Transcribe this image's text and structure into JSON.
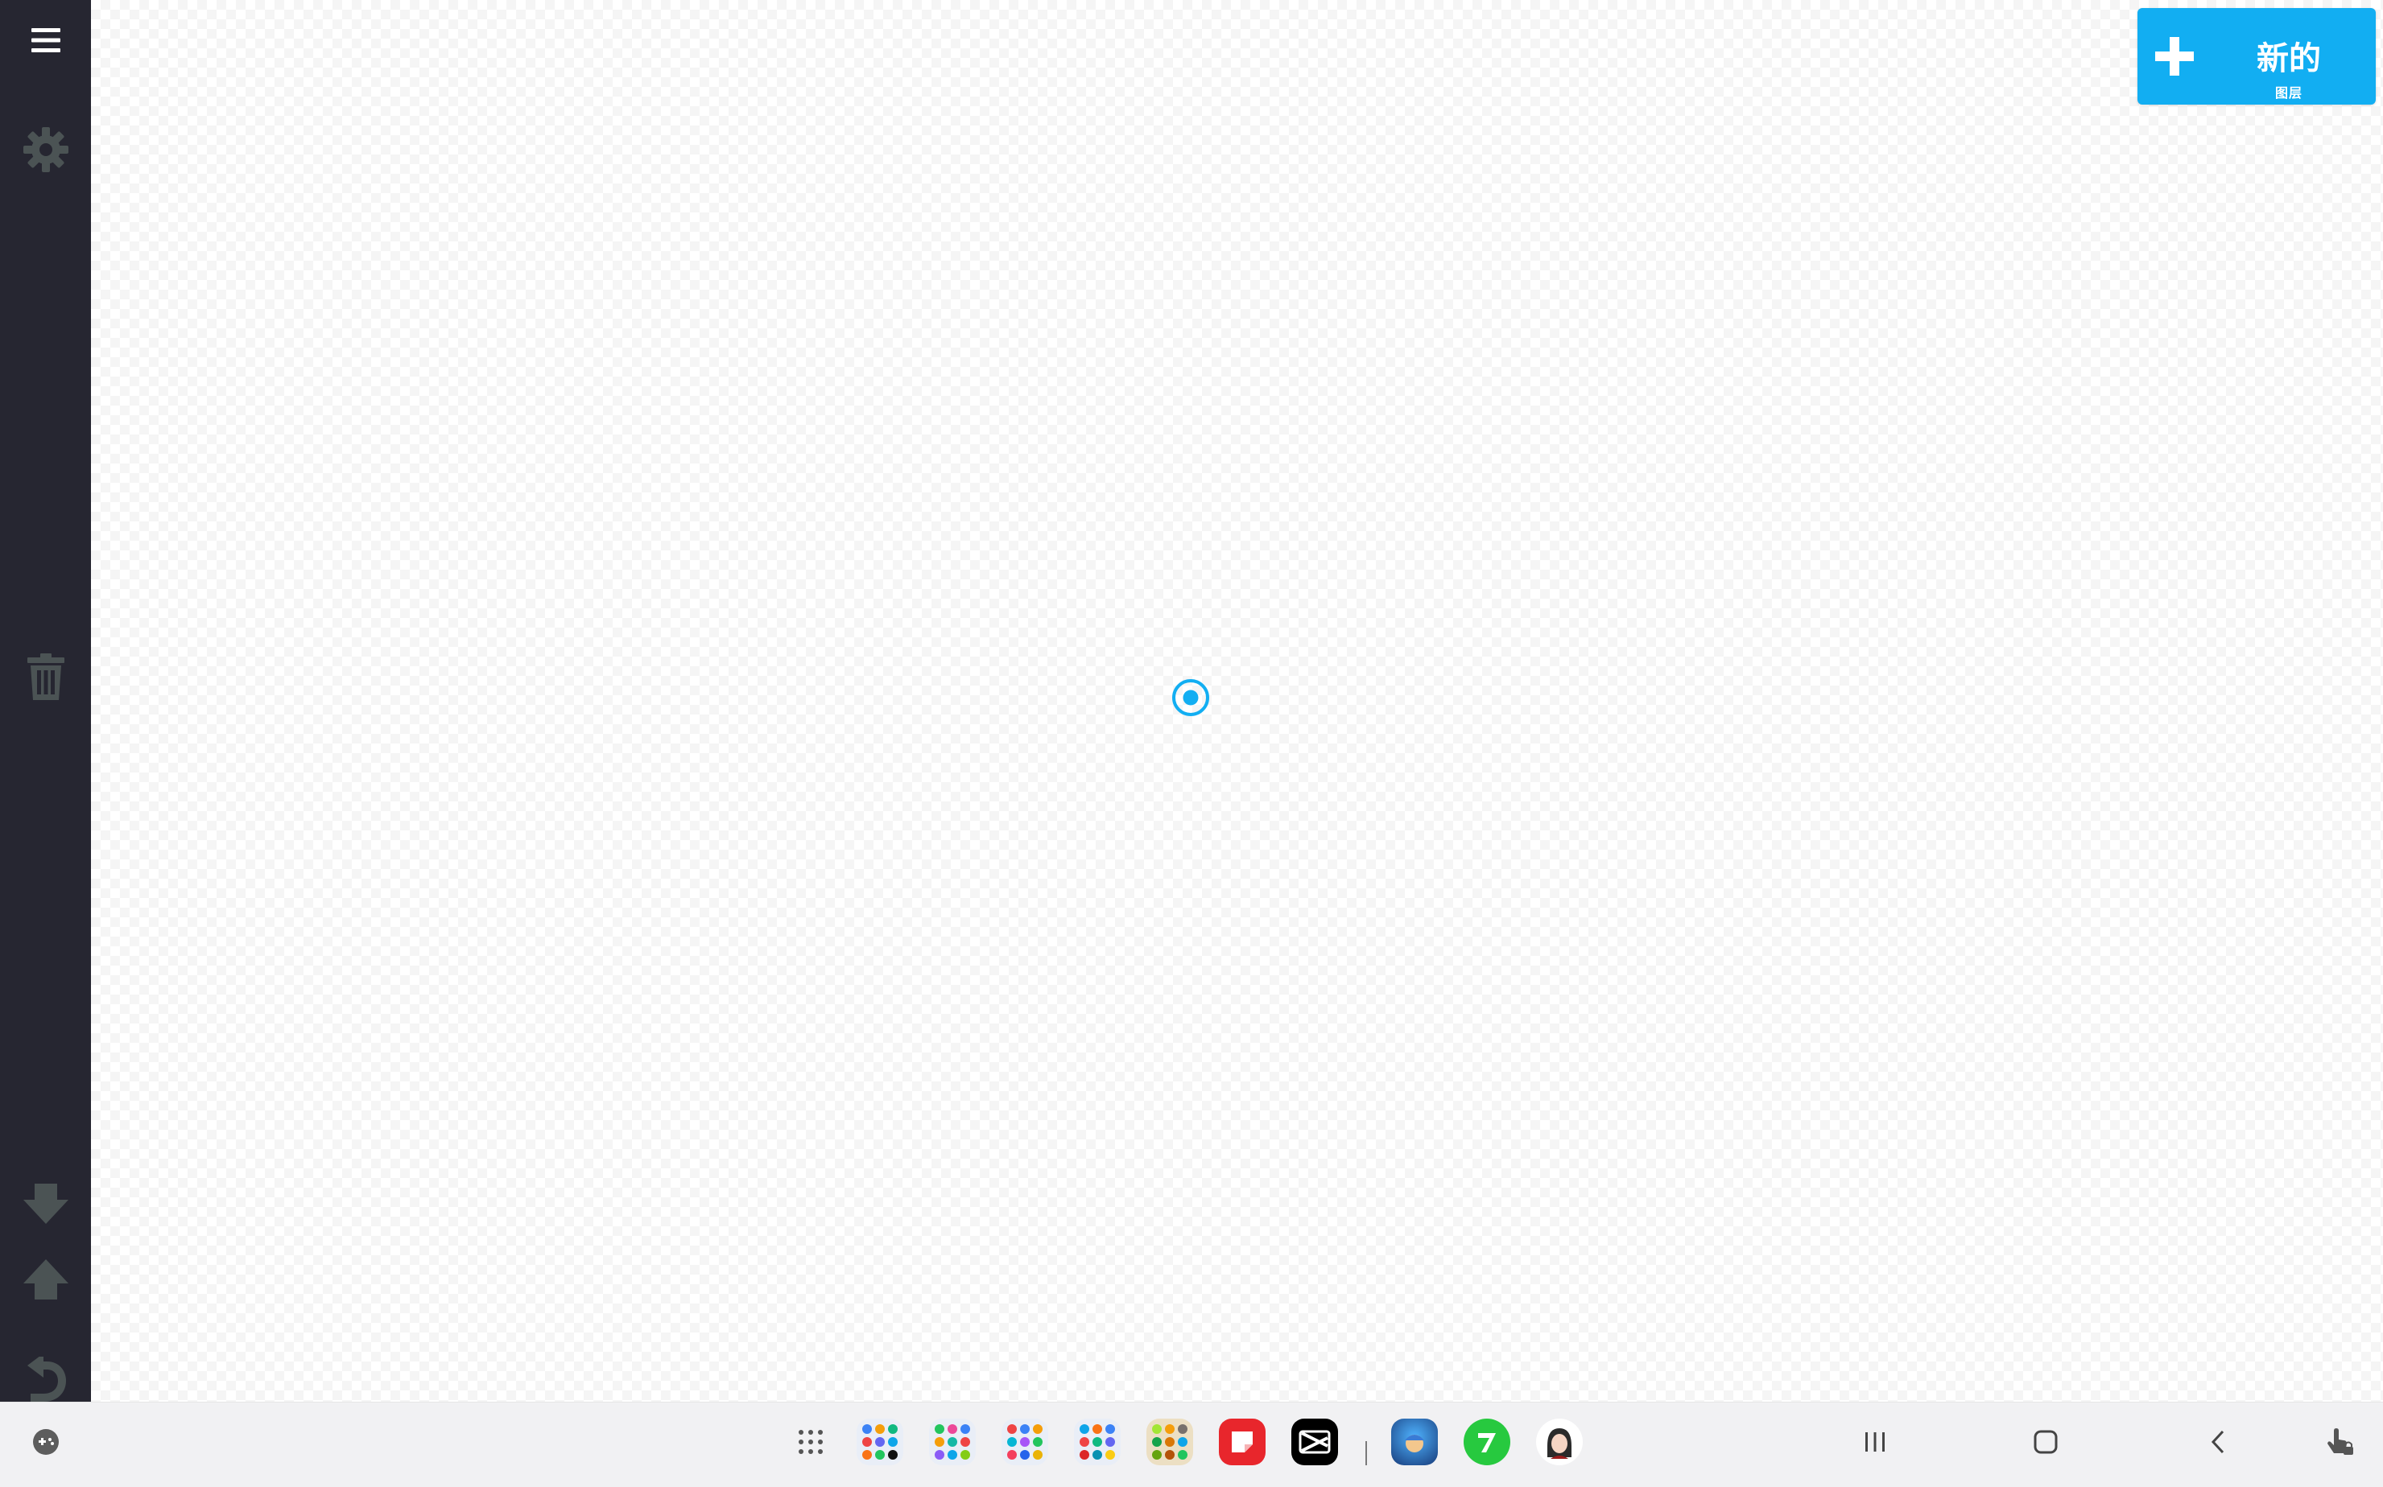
{
  "new_button": {
    "label": "新的",
    "sublabel": "图层"
  },
  "sidebar": {
    "items": [
      {
        "name": "menu",
        "icon": "hamburger-menu-icon"
      },
      {
        "name": "settings",
        "icon": "gear-icon"
      },
      {
        "name": "delete",
        "icon": "trash-icon"
      },
      {
        "name": "move-down",
        "icon": "arrow-down-icon"
      },
      {
        "name": "move-up",
        "icon": "arrow-up-icon"
      },
      {
        "name": "undo",
        "icon": "undo-icon"
      }
    ]
  },
  "taskbar": {
    "apps": [
      {
        "name": "app-drawer",
        "icon": "grid-dots-icon"
      },
      {
        "name": "folder-1",
        "icon": "folder-icon"
      },
      {
        "name": "folder-2",
        "icon": "folder-icon"
      },
      {
        "name": "folder-3",
        "icon": "folder-icon"
      },
      {
        "name": "folder-4",
        "icon": "folder-icon"
      },
      {
        "name": "folder-5",
        "icon": "folder-icon"
      },
      {
        "name": "red-app",
        "icon": "red-note-icon"
      },
      {
        "name": "capcut",
        "icon": "capcut-icon"
      },
      {
        "name": "recent-app-1",
        "icon": "blue-game-icon"
      },
      {
        "name": "recent-app-2",
        "icon": "green-seven-icon"
      },
      {
        "name": "recent-app-3",
        "icon": "avatar-icon"
      }
    ],
    "nav": [
      {
        "name": "recents",
        "icon": "recents-icon"
      },
      {
        "name": "home",
        "icon": "home-icon"
      },
      {
        "name": "back",
        "icon": "back-icon"
      },
      {
        "name": "touch-lock",
        "icon": "touch-lock-icon"
      }
    ]
  },
  "colors": {
    "accent": "#12aef2",
    "sidebar_bg": "#262631",
    "sidebar_icon": "#4b5354",
    "taskbar_bg": "#f1f1f3"
  }
}
